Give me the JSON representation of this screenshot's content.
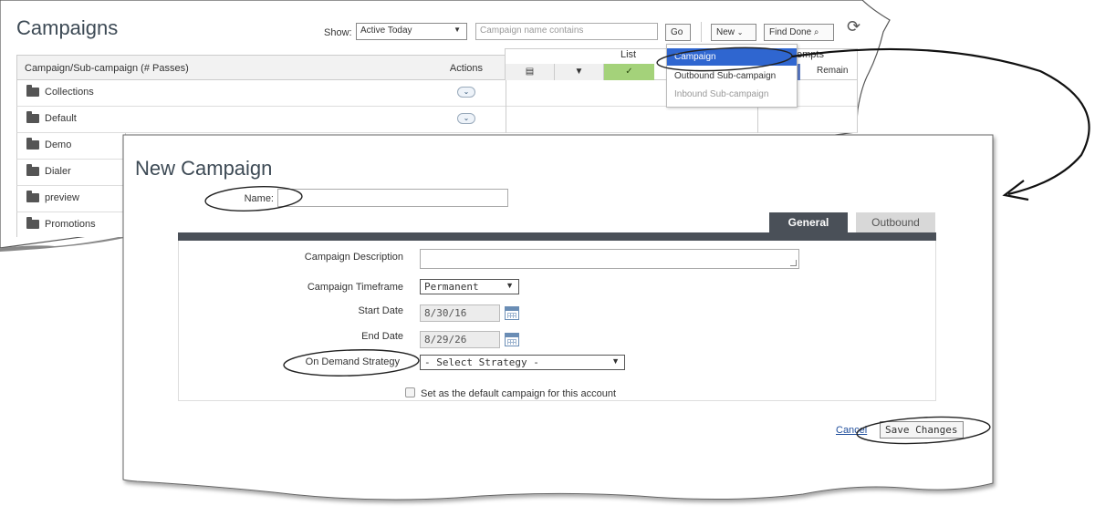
{
  "campaigns_page": {
    "title": "Campaigns",
    "show_label": "Show:",
    "show_value": "Active Today",
    "search_placeholder": "Campaign name contains",
    "go_label": "Go",
    "new_label": "New",
    "find_done_label": "Find Done",
    "table": {
      "col_name": "Campaign/Sub-campaign (# Passes)",
      "col_actions": "Actions",
      "list_label": "List",
      "attempts_label": "empts",
      "remain_label": "Remain",
      "rows": [
        "Collections",
        "Default",
        "Demo",
        "Dialer",
        "preview",
        "Promotions"
      ]
    },
    "new_menu": {
      "items": [
        {
          "label": "Campaign",
          "state": "selected"
        },
        {
          "label": "Outbound Sub-campaign",
          "state": "normal"
        },
        {
          "label": "Inbound Sub-campaign",
          "state": "disabled"
        }
      ]
    }
  },
  "new_campaign": {
    "title": "New Campaign",
    "name_label": "Name:",
    "tabs": [
      "General",
      "Outbound"
    ],
    "fields": {
      "description_label": "Campaign Description",
      "timeframe_label": "Campaign Timeframe",
      "timeframe_value": "Permanent",
      "start_label": "Start Date",
      "start_value": "8/30/16",
      "end_label": "End Date",
      "end_value": "8/29/26",
      "strategy_label": "On Demand Strategy",
      "strategy_value": "- Select Strategy -"
    },
    "default_checkbox_label": "Set as the default campaign for this account",
    "cancel_label": "Cancel",
    "save_label": "Save Changes"
  },
  "colors": {
    "accent": "#2f66d0",
    "tab_active": "#4a5058",
    "list_green": "#a4d27a"
  }
}
